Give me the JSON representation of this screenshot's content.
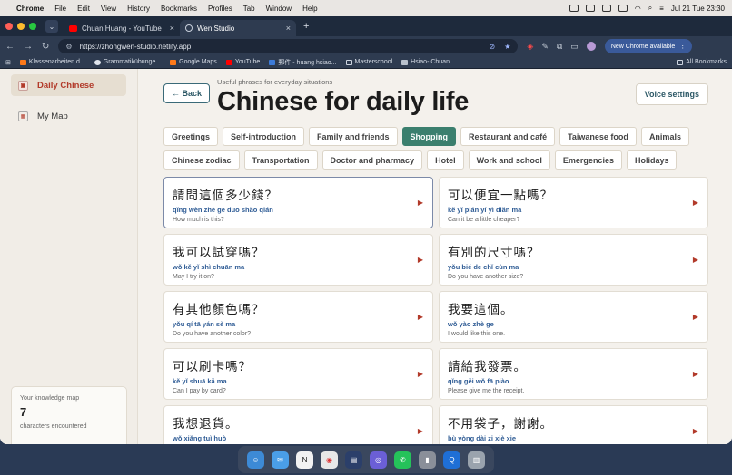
{
  "menubar": {
    "app": "Chrome",
    "items": [
      "File",
      "Edit",
      "View",
      "History",
      "Bookmarks",
      "Profiles",
      "Tab",
      "Window",
      "Help"
    ],
    "clock": "Jul 21 Tue  23:30"
  },
  "tabs": [
    {
      "title": "Chuan Huang - YouTube",
      "favicon": "youtube-icon"
    },
    {
      "title": "Wen Studio",
      "favicon": "globe-icon"
    }
  ],
  "url": "https://zhongwen-studio.netlify.app",
  "chrome_available": "New Chrome available",
  "bookmarks": [
    {
      "label": "Klassenarbeiten.d...",
      "icon": "orange"
    },
    {
      "label": "Grammatikübunge...",
      "icon": "wp"
    },
    {
      "label": "Google Maps",
      "icon": "orange"
    },
    {
      "label": "YouTube",
      "icon": "yt"
    },
    {
      "label": "郵件 - huang hsiao...",
      "icon": "blue"
    },
    {
      "label": "Masterschool",
      "icon": "folder"
    },
    {
      "label": "Hsiao- Chuan",
      "icon": "gray"
    }
  ],
  "all_bookmarks": "All Bookmarks",
  "sidebar": {
    "items": [
      {
        "label": "Daily Chinese",
        "active": true
      },
      {
        "label": "My Map",
        "active": false
      }
    ],
    "knowledge": {
      "title": "Your knowledge map",
      "count": "7",
      "subtitle": "characters encountered"
    }
  },
  "header": {
    "back": "← Back",
    "subtitle": "Useful phrases for everyday situations",
    "title": "Chinese for daily life",
    "voice_settings": "Voice settings"
  },
  "categories": [
    {
      "label": "Greetings",
      "active": false
    },
    {
      "label": "Self-introduction",
      "active": false
    },
    {
      "label": "Family and friends",
      "active": false
    },
    {
      "label": "Shopping",
      "active": true
    },
    {
      "label": "Restaurant and café",
      "active": false
    },
    {
      "label": "Taiwanese food",
      "active": false
    },
    {
      "label": "Animals",
      "active": false
    },
    {
      "label": "Chinese zodiac",
      "active": false
    },
    {
      "label": "Transportation",
      "active": false
    },
    {
      "label": "Doctor and pharmacy",
      "active": false
    },
    {
      "label": "Hotel",
      "active": false
    },
    {
      "label": "Work and school",
      "active": false
    },
    {
      "label": "Emergencies",
      "active": false
    },
    {
      "label": "Holidays",
      "active": false
    }
  ],
  "phrases": [
    {
      "zh": "請問這個多少錢？",
      "py": "qǐng wèn zhè ge duō shǎo qián",
      "en": "How much is this?"
    },
    {
      "zh": "可以便宜一點嗎？",
      "py": "kě yǐ pián yí yì diǎn ma",
      "en": "Can it be a little cheaper?"
    },
    {
      "zh": "我可以試穿嗎？",
      "py": "wǒ kě yǐ shì chuān ma",
      "en": "May I try it on?"
    },
    {
      "zh": "有別的尺寸嗎？",
      "py": "yǒu bié de chǐ cùn ma",
      "en": "Do you have another size?"
    },
    {
      "zh": "有其他顏色嗎？",
      "py": "yǒu qí tā yán sè ma",
      "en": "Do you have another color?"
    },
    {
      "zh": "我要這個。",
      "py": "wǒ yào zhè ge",
      "en": "I would like this one."
    },
    {
      "zh": "可以刷卡嗎？",
      "py": "kě yǐ shuā kǎ ma",
      "en": "Can I pay by card?"
    },
    {
      "zh": "請給我發票。",
      "py": "qǐng gěi wǒ fā piào",
      "en": "Please give me the receipt."
    },
    {
      "zh": "我想退貨。",
      "py": "wǒ xiǎng tuì huò",
      "en": ""
    },
    {
      "zh": "不用袋子，謝謝。",
      "py": "bù yòng dài zi xiè xie",
      "en": ""
    }
  ],
  "play_glyph": "▶",
  "dock_apps": [
    "finder",
    "mail",
    "notion",
    "chrome",
    "files",
    "discord",
    "whatsapp",
    "usb",
    "quicktime",
    "trash"
  ]
}
